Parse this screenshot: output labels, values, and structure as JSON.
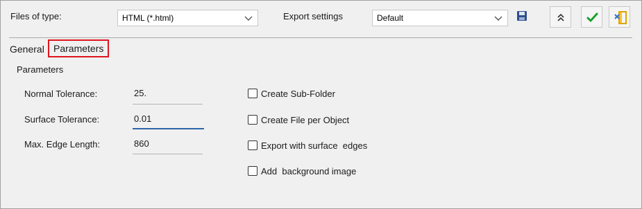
{
  "toolbar": {
    "files_of_type_label": "Files of type:",
    "files_of_type_value": "HTML (*.html)",
    "export_settings_label": "Export settings",
    "export_settings_value": "Default",
    "buttons": [
      {
        "name": "save-icon",
        "color": "#2f4f8f"
      },
      {
        "name": "collapse-icon",
        "color": "#333333"
      },
      {
        "name": "ok-icon",
        "color": "#1aa12a"
      },
      {
        "name": "exit-icon",
        "color": "#e0a400"
      }
    ]
  },
  "tabs": {
    "general": "General",
    "parameters": "Parameters",
    "highlight_color": "#e0141e"
  },
  "group": {
    "title": "Parameters"
  },
  "fields": [
    {
      "label": "Normal Tolerance:",
      "value": "25."
    },
    {
      "label": "Surface Tolerance:",
      "value": "0.01"
    },
    {
      "label": "Max. Edge Length:",
      "value": "860"
    }
  ],
  "options": [
    {
      "label": "Create Sub-Folder",
      "checked": false
    },
    {
      "label": "Create File per Object",
      "checked": false
    },
    {
      "label": "Export with surface  edges",
      "checked": false
    },
    {
      "label": "Add  background image",
      "checked": false
    }
  ]
}
